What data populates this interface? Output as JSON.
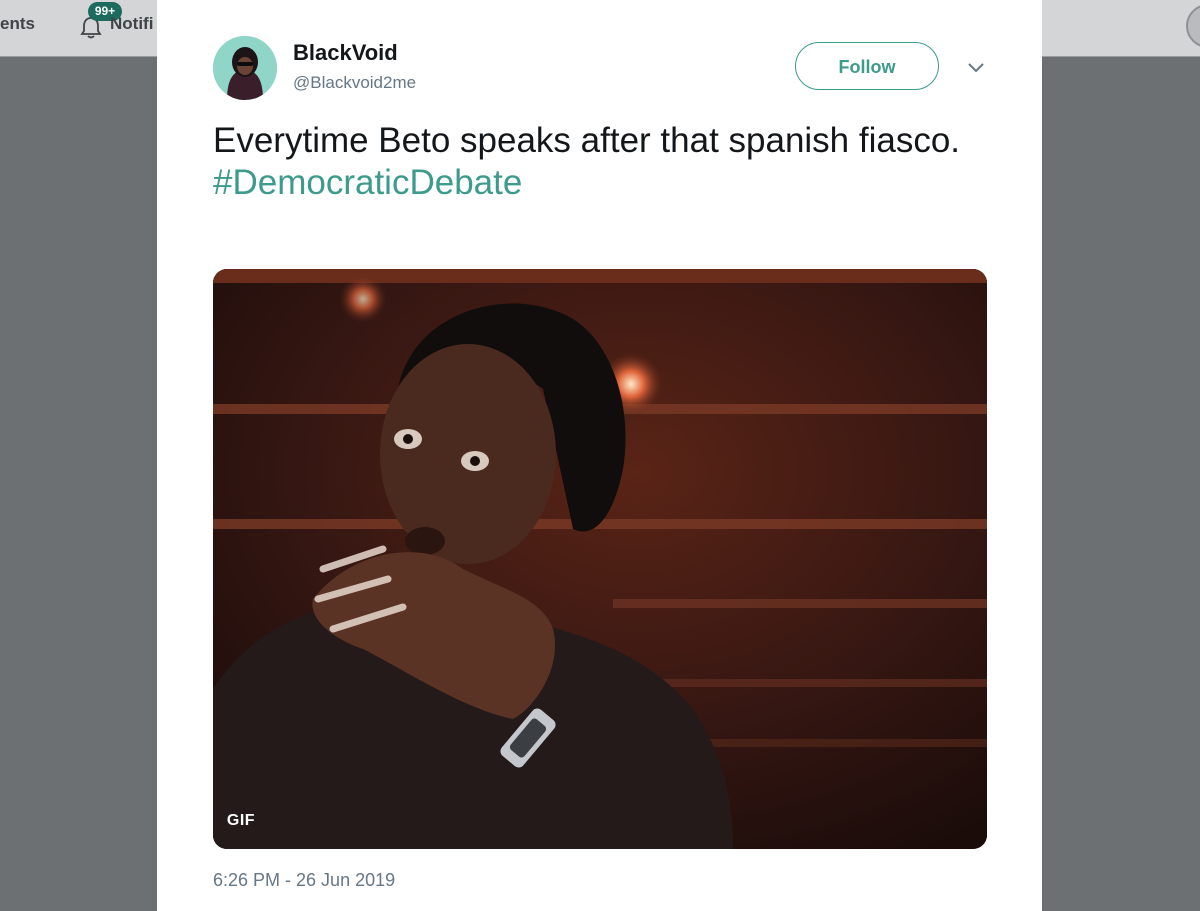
{
  "nav": {
    "moments_label": "ents",
    "notifications_label": "Notifi",
    "notifications_badge": "99+"
  },
  "tweet": {
    "author_name": "BlackVoid",
    "author_handle": "@Blackvoid2me",
    "follow_label": "Follow",
    "text_line": "Everytime Beto speaks after that spanish fiasco.",
    "hashtag": "#DemocraticDebate",
    "media_badge": "GIF",
    "timestamp": "6:26 PM - 26 Jun 2019"
  },
  "colors": {
    "accent": "#3d9b8c",
    "badge": "#1d6a5f",
    "text_primary": "#14171a",
    "text_secondary": "#657786",
    "overlay": "#6d7073"
  },
  "icons": [
    "bell-icon",
    "chevron-down-icon",
    "avatar-image"
  ]
}
